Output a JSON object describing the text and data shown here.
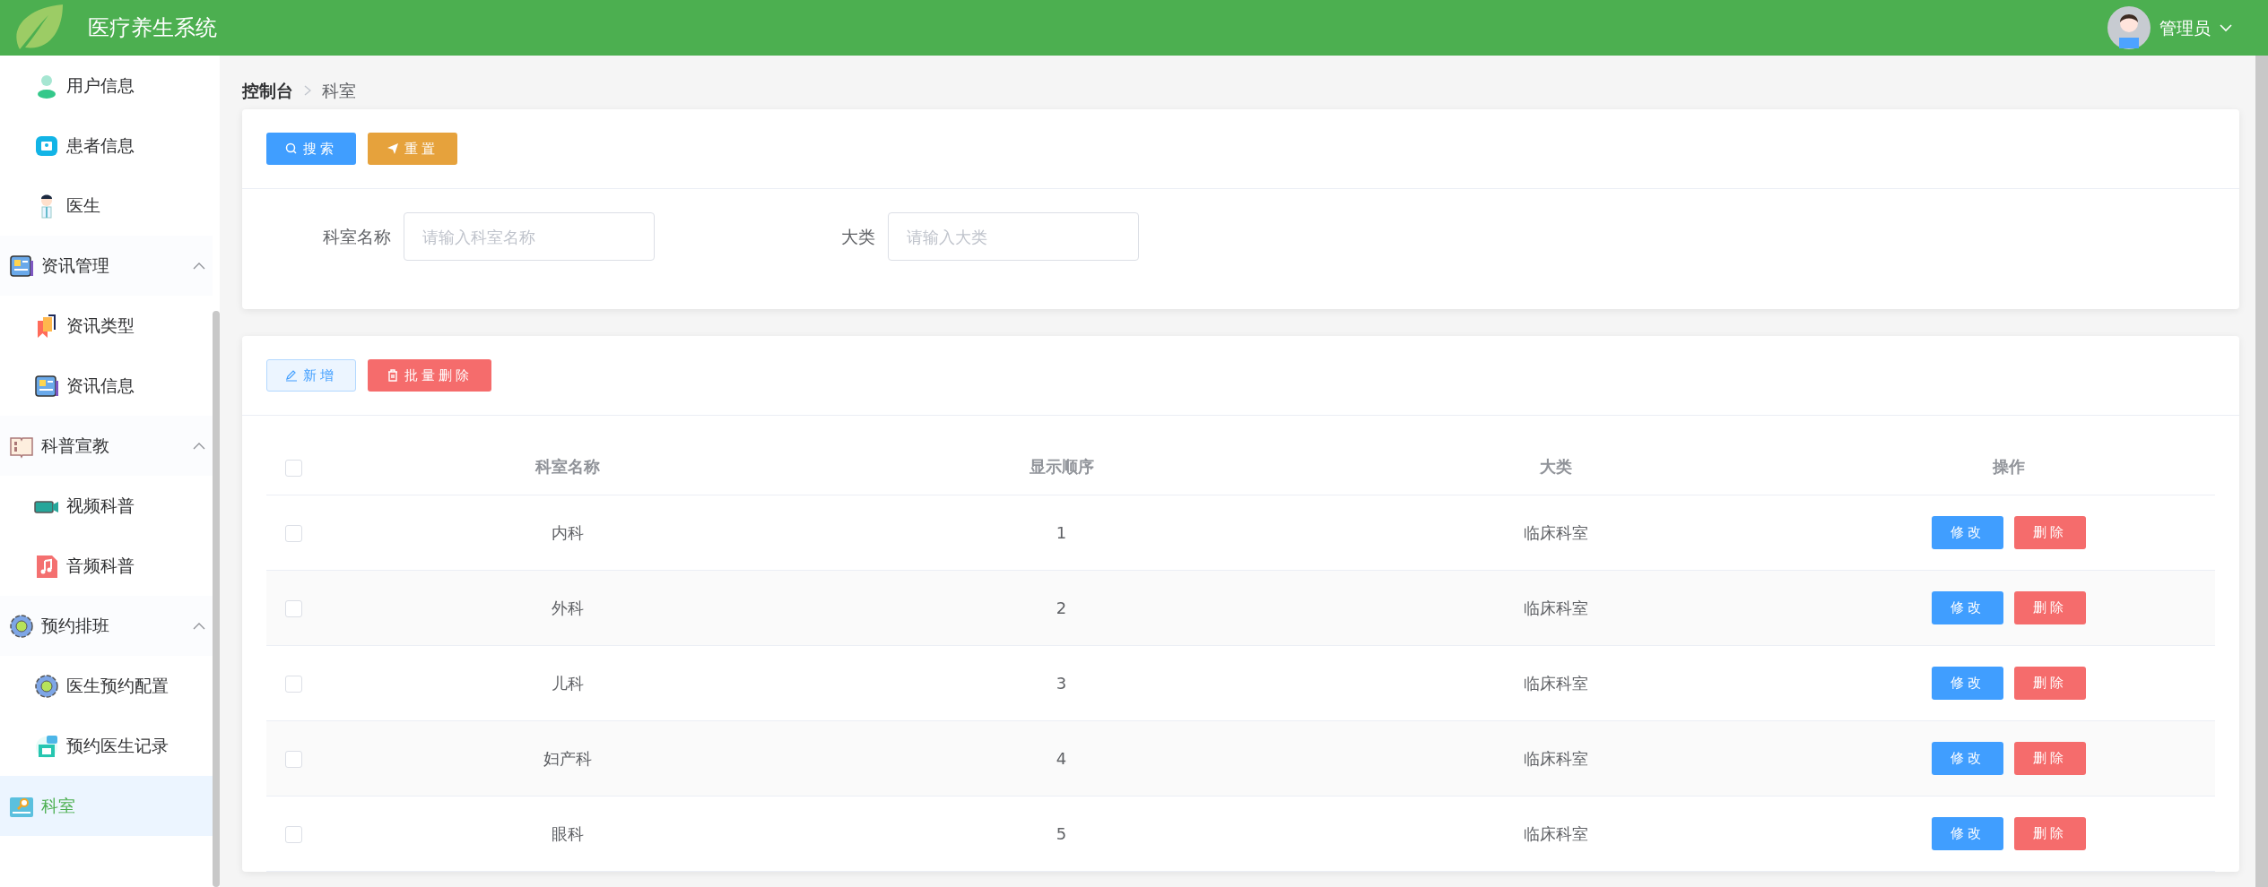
{
  "header": {
    "title": "医疗养生系统",
    "user": "管理员"
  },
  "sidebar": {
    "items": [
      {
        "children": [
          {
            "label": "用户信息",
            "selected": false
          },
          {
            "label": "患者信息",
            "selected": false
          },
          {
            "label": "医生",
            "selected": false
          }
        ]
      },
      {
        "label": "资讯管理",
        "expanded": true,
        "selected": false,
        "children": [
          {
            "label": "资讯类型",
            "selected": false
          },
          {
            "label": "资讯信息",
            "selected": false
          }
        ]
      },
      {
        "label": "科普宣教",
        "expanded": true,
        "selected": false,
        "children": [
          {
            "label": "视频科普",
            "selected": false
          },
          {
            "label": "音频科普",
            "selected": false
          }
        ]
      },
      {
        "label": "预约排班",
        "expanded": true,
        "selected": false,
        "children": [
          {
            "label": "医生预约配置",
            "selected": false
          },
          {
            "label": "预约医生记录",
            "selected": false
          }
        ]
      },
      {
        "label": "科室",
        "selected": true
      }
    ]
  },
  "breadcrumb": [
    "控制台",
    "科室"
  ],
  "search_panel": {
    "buttons": [
      {
        "label": "搜索",
        "kind": "search"
      },
      {
        "label": "重置",
        "kind": "reset"
      }
    ],
    "fields": [
      {
        "label": "科室名称",
        "placeholder": "请输入科室名称"
      },
      {
        "label": "大类",
        "placeholder": "请输入大类"
      }
    ]
  },
  "table_panel": {
    "buttons": [
      {
        "label": "新增",
        "kind": "add"
      },
      {
        "label": "批量删除",
        "kind": "delete"
      }
    ],
    "table": {
      "select_all_checked": false,
      "columns": [
        "科室名称",
        "显示顺序",
        "大类",
        "操作"
      ],
      "rows": [
        {
          "checked": false,
          "cells": [
            "内科",
            "1",
            "临床科室"
          ],
          "actions": [
            "修改",
            "删除"
          ]
        },
        {
          "checked": false,
          "cells": [
            "外科",
            "2",
            "临床科室"
          ],
          "actions": [
            "修改",
            "删除"
          ]
        },
        {
          "checked": false,
          "cells": [
            "儿科",
            "3",
            "临床科室"
          ],
          "actions": [
            "修改",
            "删除"
          ]
        },
        {
          "checked": false,
          "cells": [
            "妇产科",
            "4",
            "临床科室"
          ],
          "actions": [
            "修改",
            "删除"
          ]
        },
        {
          "checked": false,
          "cells": [
            "眼科",
            "5",
            "临床科室"
          ],
          "actions": [
            "修改",
            "删除"
          ]
        }
      ]
    }
  }
}
